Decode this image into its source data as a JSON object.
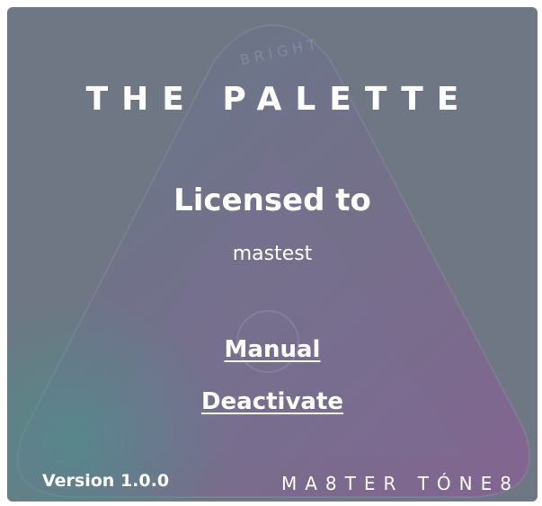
{
  "app": {
    "title": "THE PALETTE",
    "licensed_heading": "Licensed to",
    "licensee": "mastest",
    "links": {
      "manual": "Manual",
      "deactivate": "Deactivate"
    },
    "version": "Version 1.0.0",
    "brand": "MA8TER TÓNE8",
    "background_text": "BRIGHT"
  },
  "colors": {
    "panel_background": "#6f7684",
    "text": "#ffffff",
    "accent_purple": "#8a6a9a",
    "accent_teal": "#4f8a88"
  }
}
